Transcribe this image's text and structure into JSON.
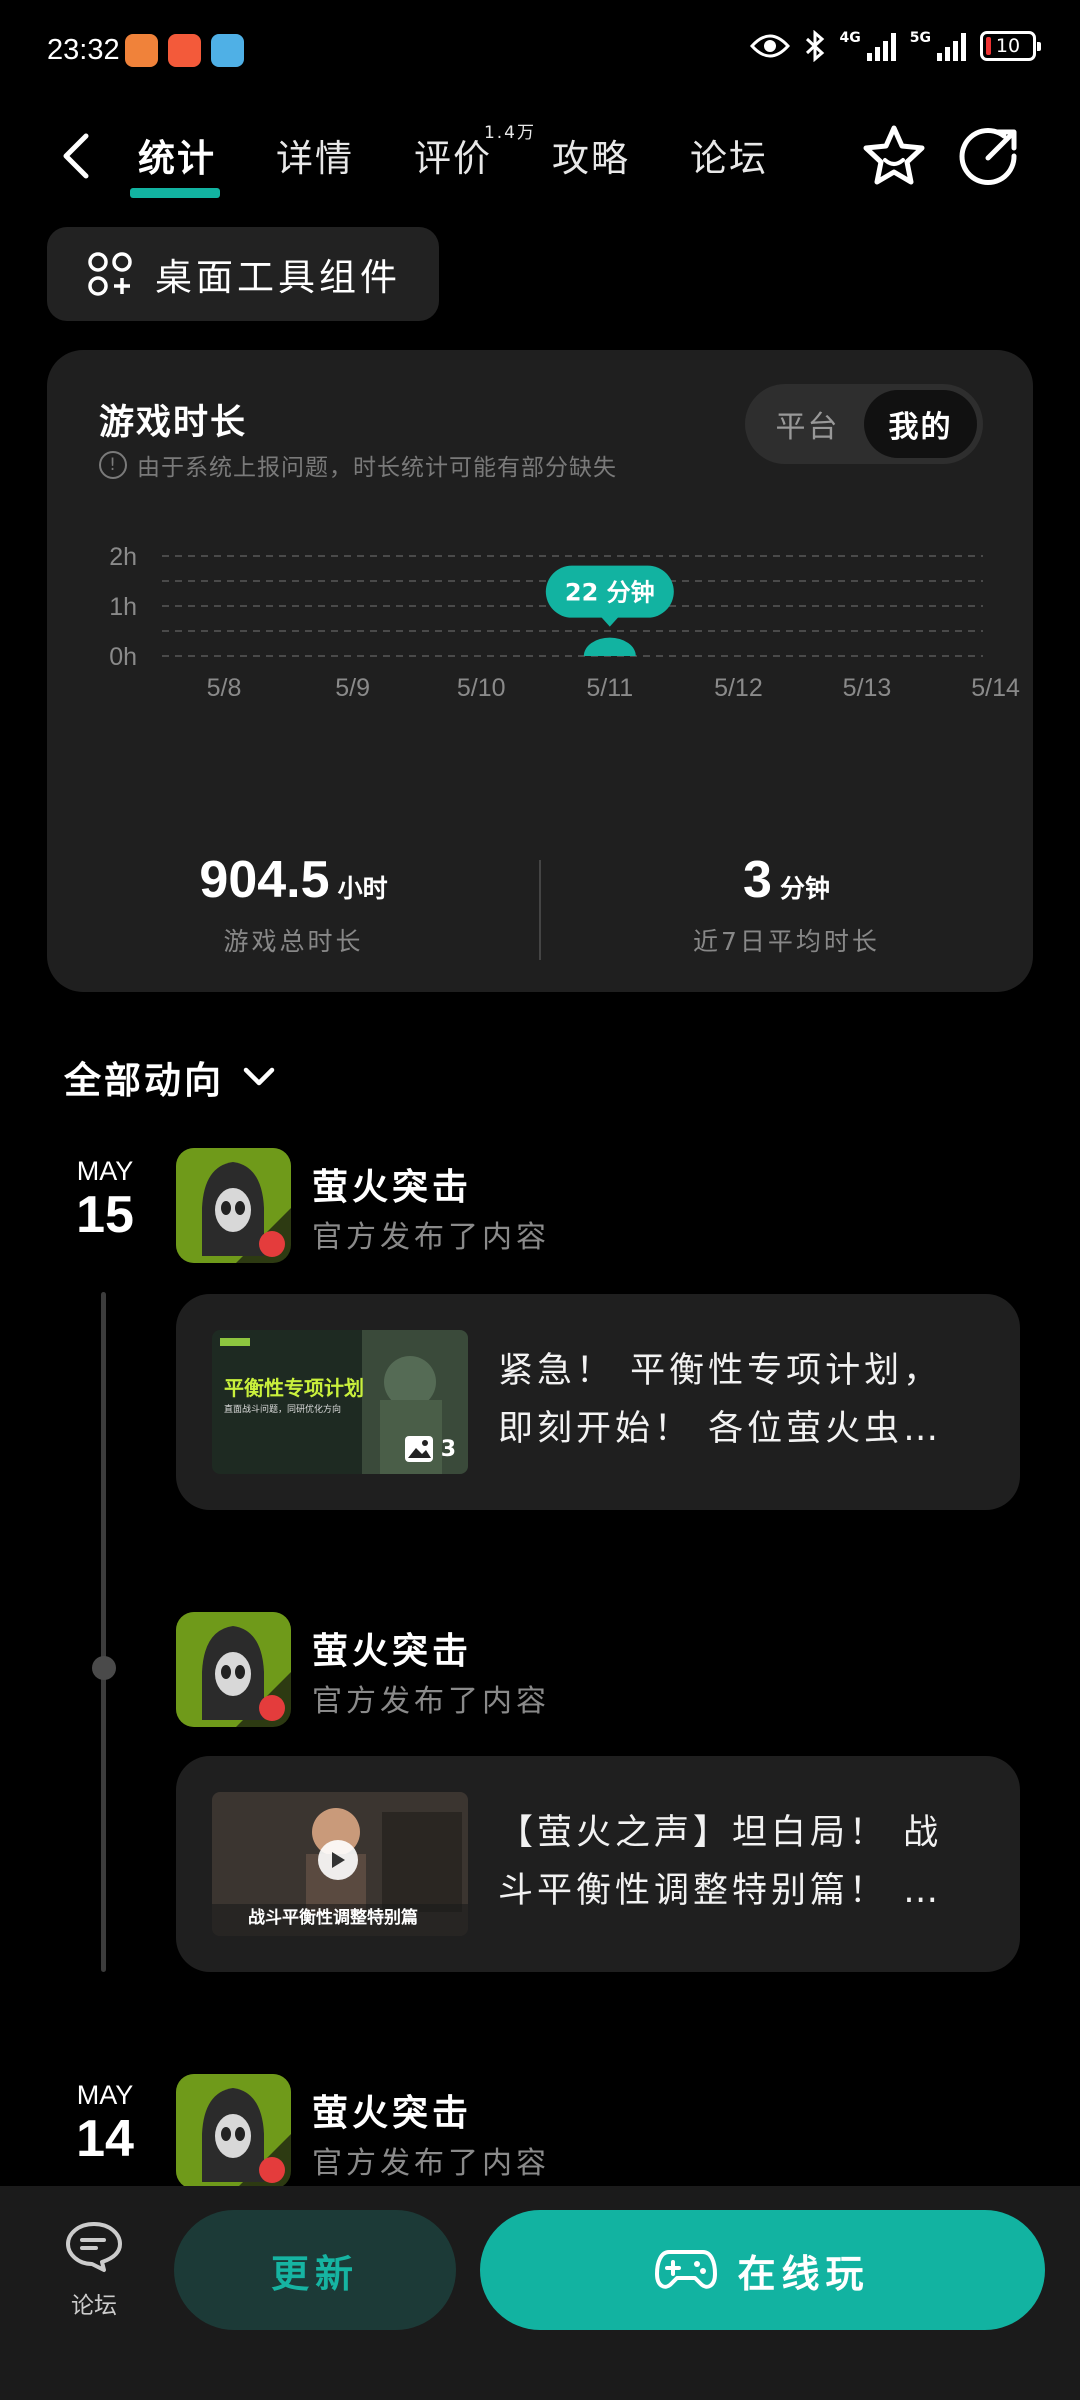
{
  "status": {
    "time": "23:32",
    "net1": "4G",
    "net2": "5G",
    "battery": "10",
    "battery_level": 0.1
  },
  "nav": {
    "tabs": [
      {
        "label": "统计",
        "active": true
      },
      {
        "label": "详情"
      },
      {
        "label": "评价",
        "badge": "1.4万"
      },
      {
        "label": "攻略"
      },
      {
        "label": "论坛"
      }
    ]
  },
  "widget_button": "桌面工具组件",
  "stats_card": {
    "title": "游戏时长",
    "note": "由于系统上报问题，时长统计可能有部分缺失",
    "segment": [
      "平台",
      "我的"
    ],
    "total": {
      "value": "904.5",
      "unit": "小时",
      "label": "游戏总时长"
    },
    "avg": {
      "value": "3",
      "unit": "分钟",
      "label": "近7日平均时长"
    }
  },
  "chart_data": {
    "type": "bar",
    "categories": [
      "5/8",
      "5/9",
      "5/10",
      "5/11",
      "5/12",
      "5/13",
      "5/14"
    ],
    "values": [
      0,
      0,
      0,
      22,
      0,
      0,
      0
    ],
    "yticks": [
      "2h",
      "1h",
      "0h"
    ],
    "ylim": [
      0,
      120
    ],
    "tooltip": "22 分钟",
    "accent": "#12b3a1"
  },
  "feed": {
    "filter": "全部动向",
    "date1": {
      "month": "MAY",
      "day": "15"
    },
    "date2": {
      "month": "MAY",
      "day": "14"
    },
    "posts": [
      {
        "name": "萤火突击",
        "sub": "官方发布了内容",
        "text": "紧急！ 平衡性专项计划，即刻开始！ 各位萤火虫…",
        "thumb_title": "平衡性专项计划",
        "thumb_caption": "直面战斗问题，同研优化方向",
        "thumb_count": "3"
      },
      {
        "name": "萤火突击",
        "sub": "官方发布了内容",
        "text": "【萤火之声】坦白局！ 战斗平衡性调整特别篇！ …",
        "thumb_caption": "战斗平衡性调整特别篇"
      },
      {
        "name": "萤火突击",
        "sub": "官方发布了内容"
      }
    ]
  },
  "bottom": {
    "forum": "论坛",
    "update": "更新",
    "play": "在线玩"
  }
}
